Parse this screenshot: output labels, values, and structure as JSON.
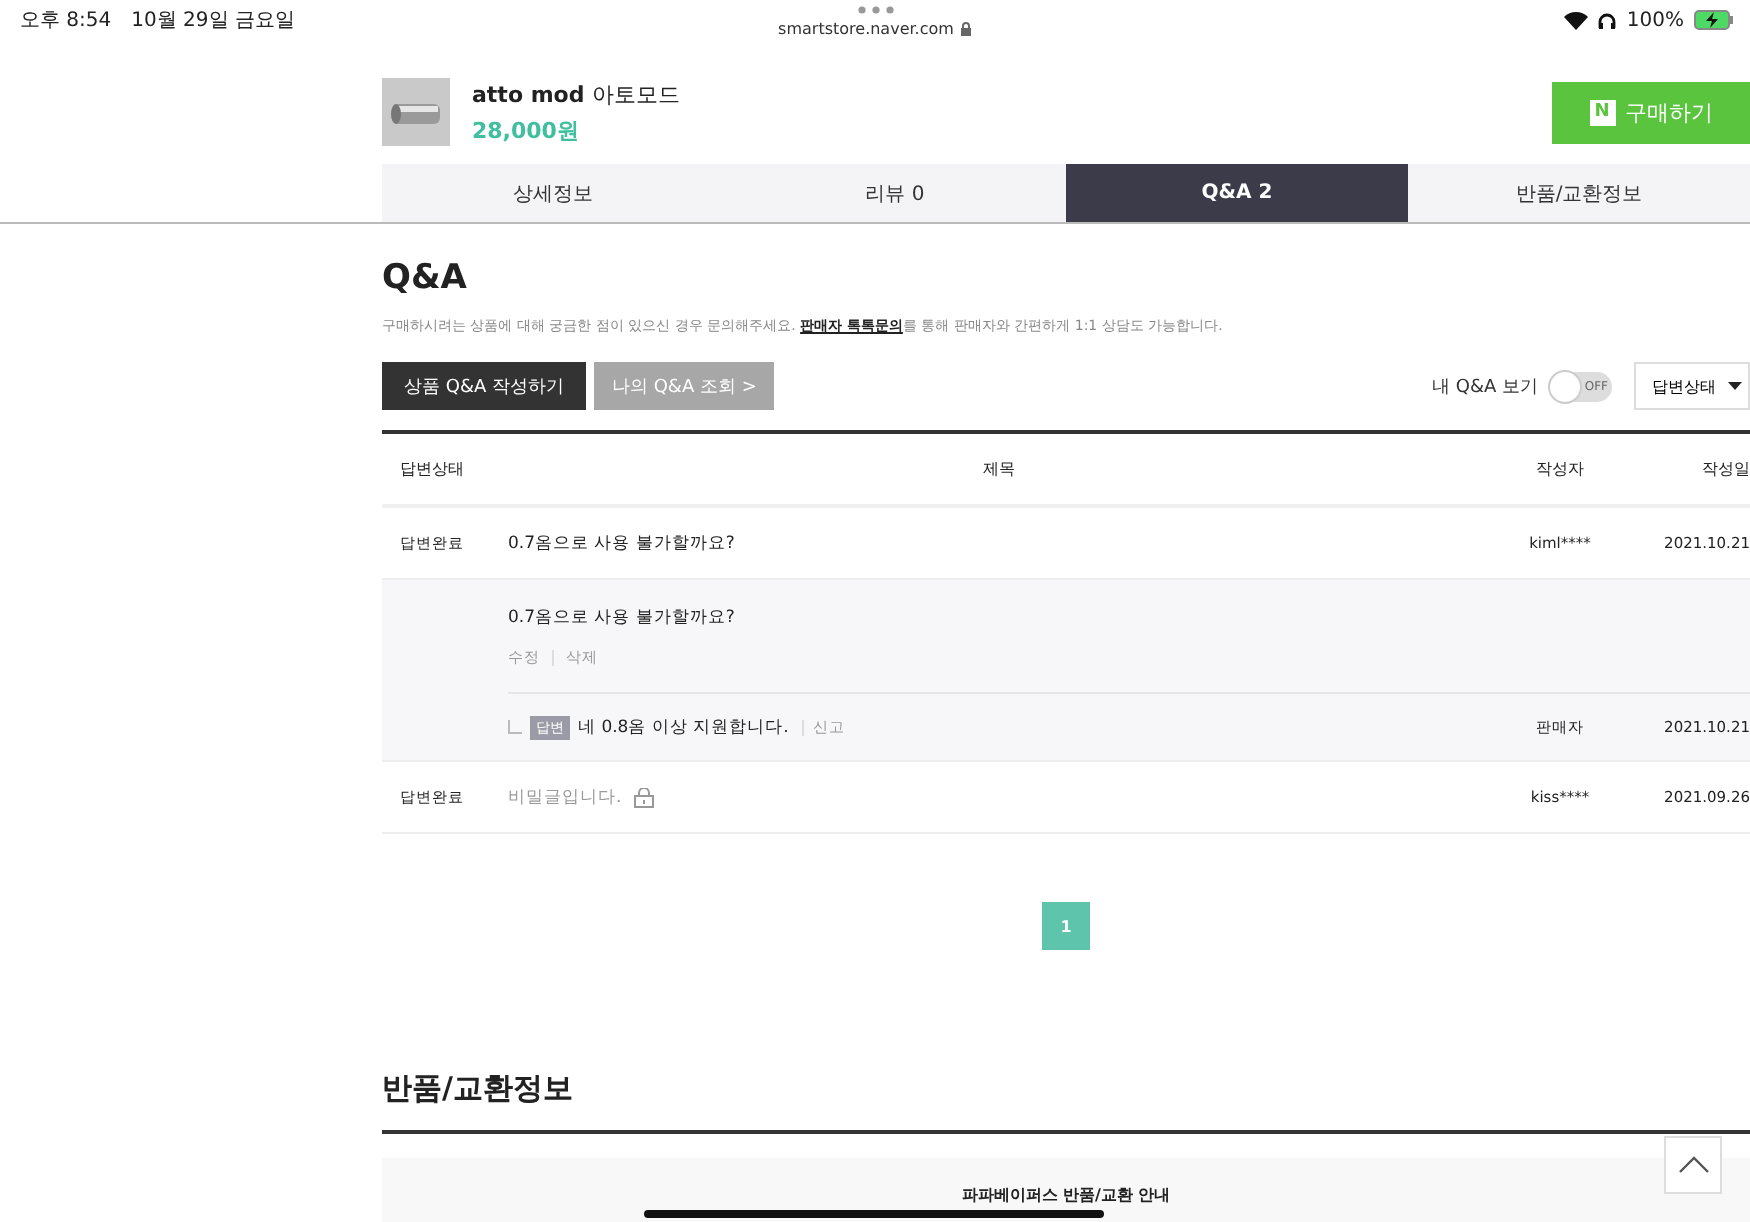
{
  "status_bar": {
    "time": "오후 8:54",
    "date": "10월 29일 금요일",
    "url": "smartstore.naver.com",
    "battery": "100%"
  },
  "product": {
    "name": "atto mod",
    "name_ko": "아토모드",
    "price": "28,000원"
  },
  "buy_button": {
    "logo": "N",
    "label": "구매하기"
  },
  "tabs": [
    {
      "label": "상세정보",
      "selected": false
    },
    {
      "label": "리뷰 0",
      "selected": false
    },
    {
      "label": "Q&A 2",
      "selected": true
    },
    {
      "label": "반품/교환정보",
      "selected": false
    }
  ],
  "qa": {
    "title": "Q&A",
    "notice_before": "구매하시려는 상품에 대해 궁금한 점이 있으신 경우 문의해주세요. ",
    "notice_link": "판매자 톡톡문의",
    "notice_after": "를 통해 판매자와 간편하게 1:1 상담도 가능합니다.",
    "write_button": "상품 Q&A 작성하기",
    "my_button": "나의 Q&A 조회 >",
    "my_toggle": {
      "label": "내 Q&A 보기",
      "on": false,
      "state_text": "OFF"
    },
    "filter": "답변상태",
    "columns": [
      "답변상태",
      "제목",
      "작성자",
      "작성일"
    ],
    "rows": [
      {
        "kind": "question",
        "status": "답변완료",
        "title": "0.7옴으로 사용 불가할까요?",
        "author": "kiml****",
        "date": "2021.10.21",
        "detail": {
          "question": "0.7옴으로 사용 불가할까요?",
          "actions": [
            "수정",
            "삭제"
          ],
          "answer_badge": "답변",
          "answer": "네 0.8옴 이상 지원합니다.",
          "report": "신고",
          "answer_author": "판매자",
          "answer_date": "2021.10.21"
        }
      },
      {
        "kind": "secret",
        "status": "답변완료",
        "title": "비밀글입니다.",
        "author": "kiss****",
        "date": "2021.09.26"
      }
    ],
    "pages": [
      {
        "label": "1",
        "selected": true
      }
    ]
  },
  "returns": {
    "title": "반품/교환정보",
    "box_title": "파파베이퍼스 반품/교환 안내"
  }
}
